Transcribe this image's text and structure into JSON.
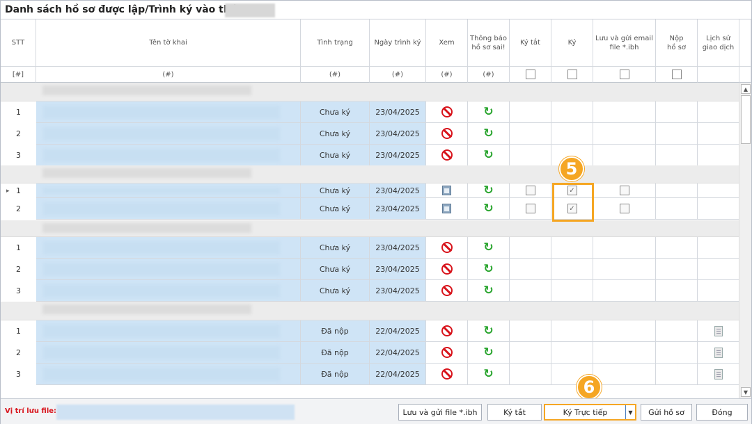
{
  "window": {
    "title": "Danh sách hồ sơ được lập/Trình ký vào tháng"
  },
  "columns": {
    "stt": "STT",
    "ten": "Tên tờ khai",
    "tinhtrang": "Tình trạng",
    "ngay": "Ngày trình ký",
    "xem": "Xem",
    "thongbao": "Thông báo\nhồ sơ sai!",
    "kytat": "Ký tắt",
    "ky": "Ký",
    "luugui": "Lưu và gửi email\nfile *.ibh",
    "nop": "Nộp\nhồ sơ",
    "lichsu": "Lịch sử\ngiao dịch"
  },
  "filter": {
    "stt": "[#]",
    "ten": "(#)",
    "tinhtrang": "(#)",
    "ngay": "(#)",
    "xem": "(#)",
    "thongbao": "(#)"
  },
  "groups": [
    {
      "rows": [
        {
          "stt": "1",
          "status": "Chưa ký",
          "date": "23/04/2025"
        },
        {
          "stt": "2",
          "status": "Chưa ký",
          "date": "23/04/2025"
        },
        {
          "stt": "3",
          "status": "Chưa ký",
          "date": "23/04/2025"
        }
      ]
    },
    {
      "rows": [
        {
          "stt": "1",
          "status": "Chưa ký",
          "date": "23/04/2025",
          "kytat": false,
          "ky": true,
          "luu": false
        },
        {
          "stt": "2",
          "status": "Chưa ký",
          "date": "23/04/2025",
          "kytat": false,
          "ky": true,
          "luu": false
        }
      ]
    },
    {
      "rows": [
        {
          "stt": "1",
          "status": "Chưa ký",
          "date": "23/04/2025"
        },
        {
          "stt": "2",
          "status": "Chưa ký",
          "date": "23/04/2025"
        },
        {
          "stt": "3",
          "status": "Chưa ký",
          "date": "23/04/2025"
        }
      ]
    },
    {
      "rows": [
        {
          "stt": "1",
          "status": "Đã nộp",
          "date": "22/04/2025"
        },
        {
          "stt": "2",
          "status": "Đã nộp",
          "date": "22/04/2025"
        },
        {
          "stt": "3",
          "status": "Đã nộp",
          "date": "22/04/2025"
        }
      ]
    }
  ],
  "icons": {
    "xem_blocked": "no-entry-icon",
    "xem_view": "document-view-icon",
    "thongbao": "refresh-icon",
    "lichsu": "history-doc-icon",
    "row_pointer": "▸"
  },
  "annotations": {
    "step5": "5",
    "step6": "6"
  },
  "footer": {
    "label": "Vị trí lưu file:",
    "btn_luu": "Lưu và gửi file *.ibh",
    "btn_kytat": "Ký tắt",
    "btn_kytructiep": "Ký Trực tiếp",
    "btn_gui": "Gửi hồ sơ",
    "btn_dong": "Đóng"
  },
  "colors": {
    "accent": "#f5a623",
    "blue_cell": "#cfe4f6",
    "error": "#d8141c",
    "ok": "#2aa52f"
  }
}
